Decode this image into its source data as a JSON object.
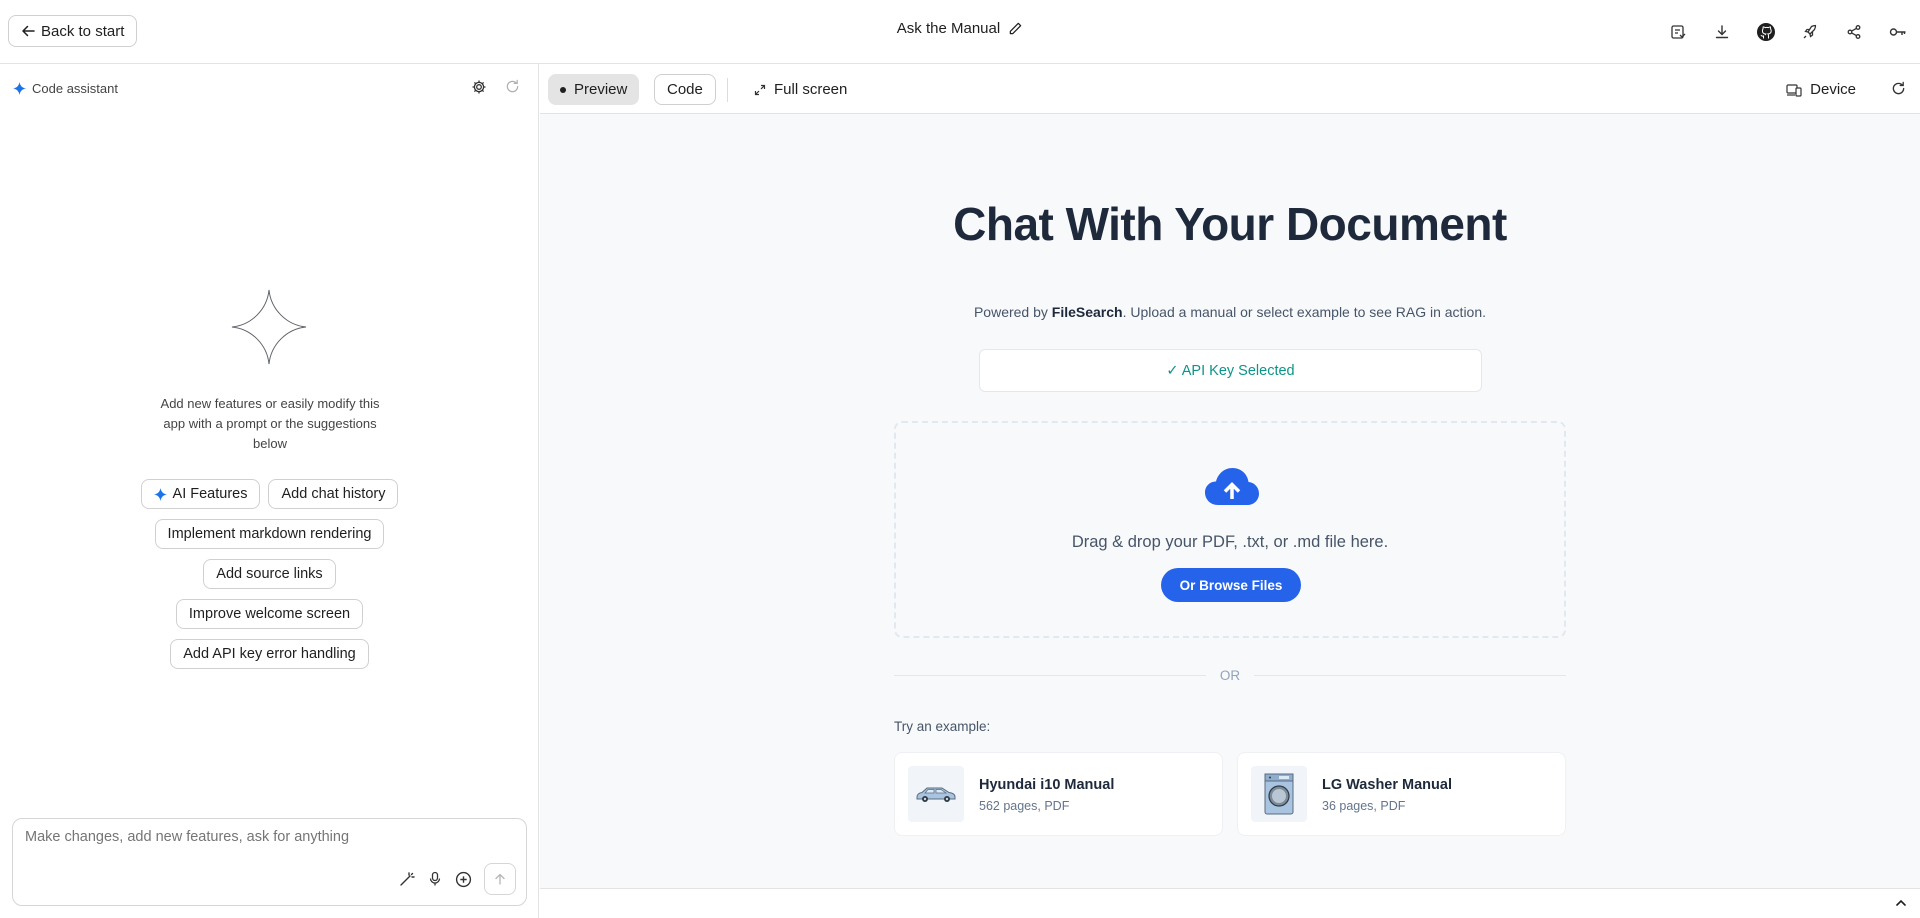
{
  "topbar": {
    "back_label": "Back to start",
    "app_title": "Ask the Manual",
    "actions": [
      "save-icon",
      "download-icon",
      "github-icon",
      "rocket-icon",
      "share-icon",
      "key-icon"
    ]
  },
  "assistant": {
    "title": "Code assistant",
    "welcome": "Add new features or easily modify this app with a prompt or the suggestions below",
    "suggestions": [
      "AI Features",
      "Add chat history",
      "Implement markdown rendering",
      "Add source links",
      "Improve welcome screen",
      "Add API key error handling"
    ],
    "prompt_placeholder": "Make changes, add new features, ask for anything"
  },
  "preview_toolbar": {
    "preview_label": "Preview",
    "code_label": "Code",
    "fullscreen_label": "Full screen",
    "device_label": "Device"
  },
  "app": {
    "heading": "Chat With Your Document",
    "subtitle_prefix": "Powered by ",
    "subtitle_brand": "FileSearch",
    "subtitle_suffix": ". Upload a manual or select example to see RAG in action.",
    "api_status": "✓ API Key Selected",
    "drop_text": "Drag & drop your PDF, .txt, or .md file here.",
    "browse_label": "Or Browse Files",
    "or_label": "OR",
    "try_label": "Try an example:",
    "examples": [
      {
        "title": "Hyundai i10 Manual",
        "meta": "562 pages, PDF"
      },
      {
        "title": "LG Washer Manual",
        "meta": "36 pages, PDF"
      }
    ]
  },
  "colors": {
    "accent": "#2563eb",
    "success": "#0d9488",
    "heading": "#1e293b"
  }
}
